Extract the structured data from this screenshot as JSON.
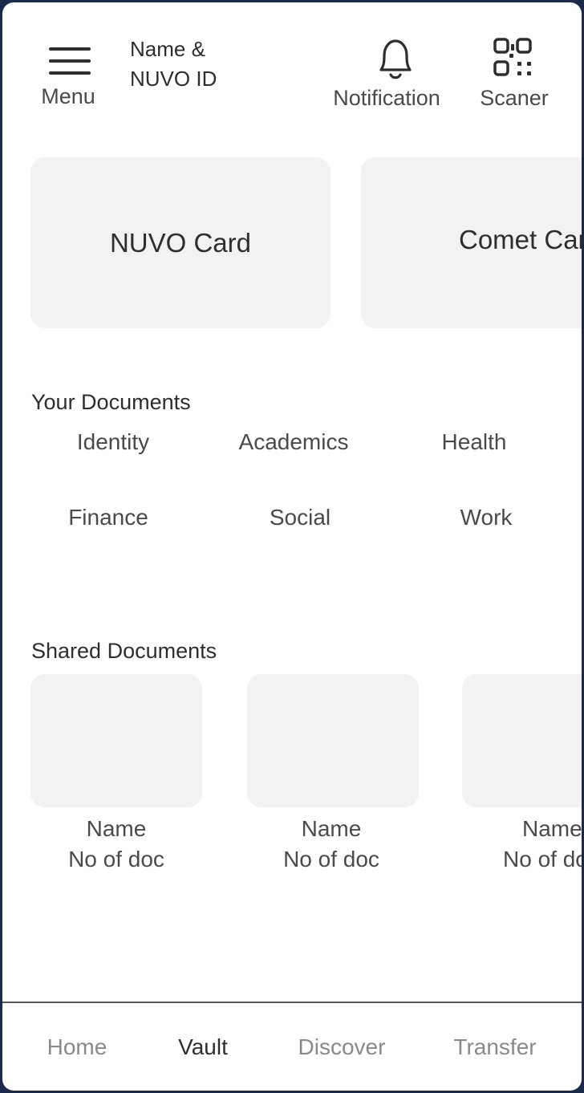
{
  "header": {
    "menu_label": "Menu",
    "name_line1": "Name &",
    "name_line2": "NUVO ID",
    "notification_label": "Notification",
    "scanner_label": "Scaner"
  },
  "cards": [
    {
      "label": "NUVO Card"
    },
    {
      "label": "Comet Card"
    }
  ],
  "your_documents": {
    "title": "Your Documents",
    "categories": [
      "Identity",
      "Academics",
      "Health",
      "Finance",
      "Social",
      "Work"
    ]
  },
  "shared_documents": {
    "title": "Shared Documents",
    "items": [
      {
        "name": "Name",
        "count": "No of doc"
      },
      {
        "name": "Name",
        "count": "No of doc"
      },
      {
        "name": "Name",
        "count": "No of doc"
      }
    ]
  },
  "bottom_nav": {
    "items": [
      "Home",
      "Vault",
      "Discover",
      "Transfer"
    ],
    "active": "Vault"
  },
  "colors": {
    "tile_bg": "#f2f2f2",
    "text_primary": "#2e2e2e",
    "text_secondary": "#4a4a4a",
    "nav_inactive": "#8a8a8a",
    "frame": "#1b2a4a"
  }
}
